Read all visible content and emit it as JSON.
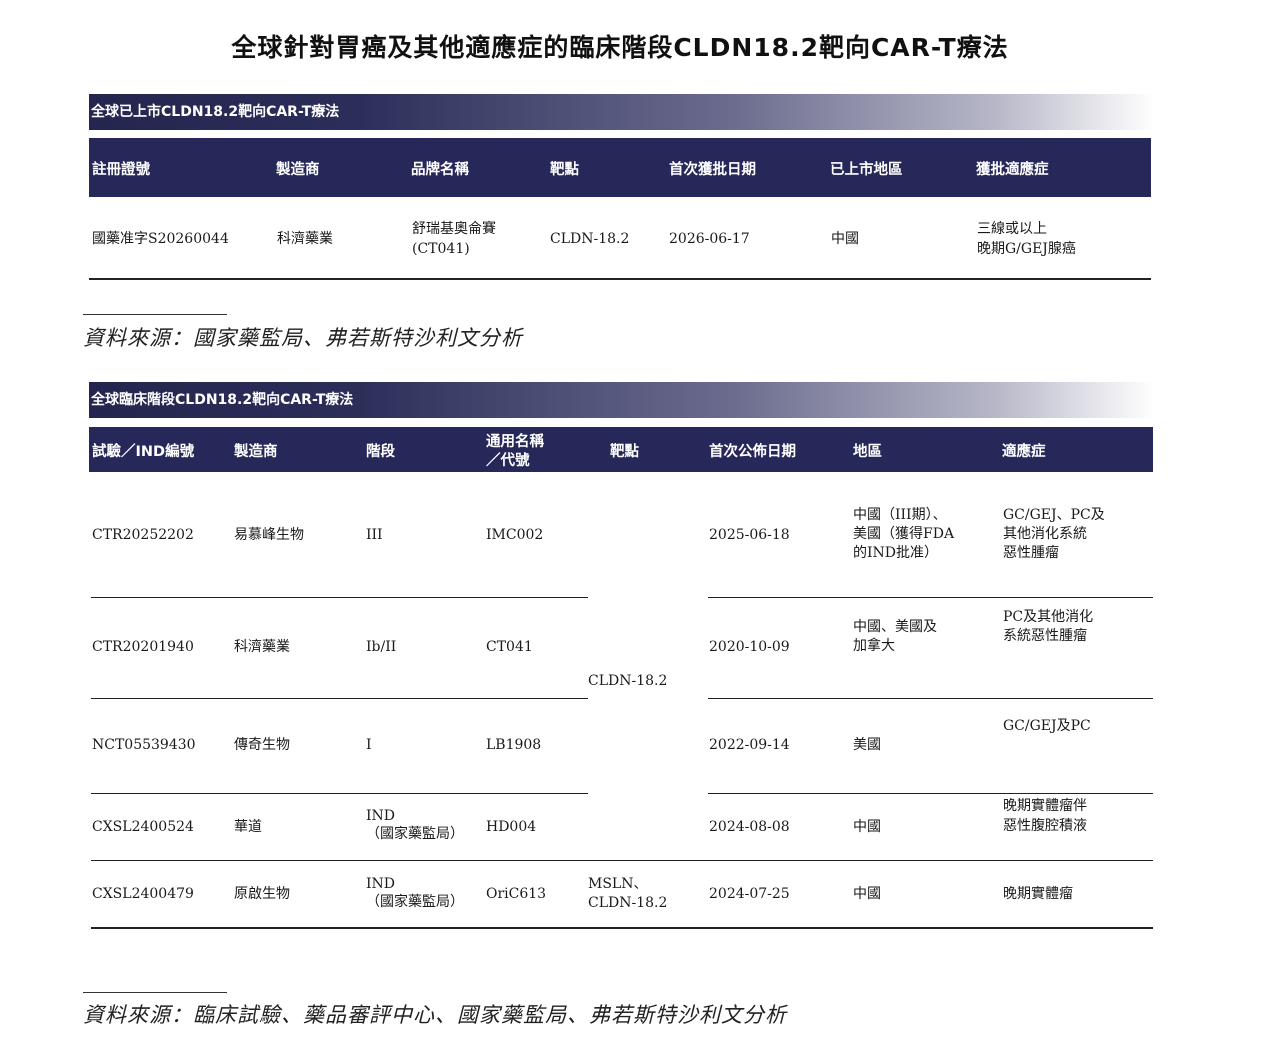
{
  "title": "全球針對胃癌及其他適應症的臨床階段CLDN18.2靶向CAR-T療法",
  "table1": {
    "band": "全球已上市CLDN18.2靶向CAR-T療法",
    "headers": [
      "註冊證號",
      "製造商",
      "品牌名稱",
      "靶點",
      "首次獲批日期",
      "已上市地區",
      "獲批適應症"
    ],
    "row": {
      "reg_no": "國藥准字S20260044",
      "maker": "科濟藥業",
      "brand_l1": "舒瑞基奧侖賽",
      "brand_l2": "(CT041)",
      "target": "CLDN-18.2",
      "date": "2026-06-17",
      "region": "中國",
      "indication_l1": "三線或以上",
      "indication_l2": "晚期G/GEJ腺癌"
    }
  },
  "source1": "資料來源：國家藥監局、弗若斯特沙利文分析",
  "table2": {
    "band": "全球臨床階段CLDN18.2靶向CAR-T療法",
    "headers": {
      "trial": "試驗／IND編號",
      "maker": "製造商",
      "phase": "階段",
      "generic_l1": "通用名稱",
      "generic_l2": "／代號",
      "target": "靶點",
      "date": "首次公佈日期",
      "region": "地區",
      "indication": "適應症"
    },
    "shared_target": "CLDN-18.2",
    "rows": [
      {
        "trial": "CTR20252202",
        "maker": "易慕峰生物",
        "phase": "III",
        "code": "IMC002",
        "date": "2025-06-18",
        "region_l1": "中國（III期）、",
        "region_l2": "美國（獲得FDA",
        "region_l3": "的IND批准）",
        "ind_l1": "GC/GEJ、PC及",
        "ind_l2": "其他消化系統",
        "ind_l3": "惡性腫瘤"
      },
      {
        "trial": "CTR20201940",
        "maker": "科濟藥業",
        "phase": "Ib/II",
        "code": "CT041",
        "date": "2020-10-09",
        "region_l1": "中國、美國及",
        "region_l2": "加拿大",
        "ind_l1": "PC及其他消化",
        "ind_l2": "系統惡性腫瘤"
      },
      {
        "trial": "NCT05539430",
        "maker": "傳奇生物",
        "phase": "I",
        "code": "LB1908",
        "date": "2022-09-14",
        "region": "美國",
        "ind": "GC/GEJ及PC"
      },
      {
        "trial": "CXSL2400524",
        "maker": "華道",
        "phase_l1": "IND",
        "phase_l2": "（國家藥監局）",
        "code": "HD004",
        "date": "2024-08-08",
        "region": "中國",
        "ind_l1": "晚期實體瘤伴",
        "ind_l2": "惡性腹腔積液"
      },
      {
        "trial": "CXSL2400479",
        "maker": "原啟生物",
        "phase_l1": "IND",
        "phase_l2": "（國家藥監局）",
        "code": "OriC613",
        "target_l1": "MSLN、",
        "target_l2": "CLDN-18.2",
        "date": "2024-07-25",
        "region": "中國",
        "ind": "晚期實體瘤"
      }
    ]
  },
  "source2": "資料來源：臨床試驗、藥品審評中心、國家藥監局、弗若斯特沙利文分析"
}
